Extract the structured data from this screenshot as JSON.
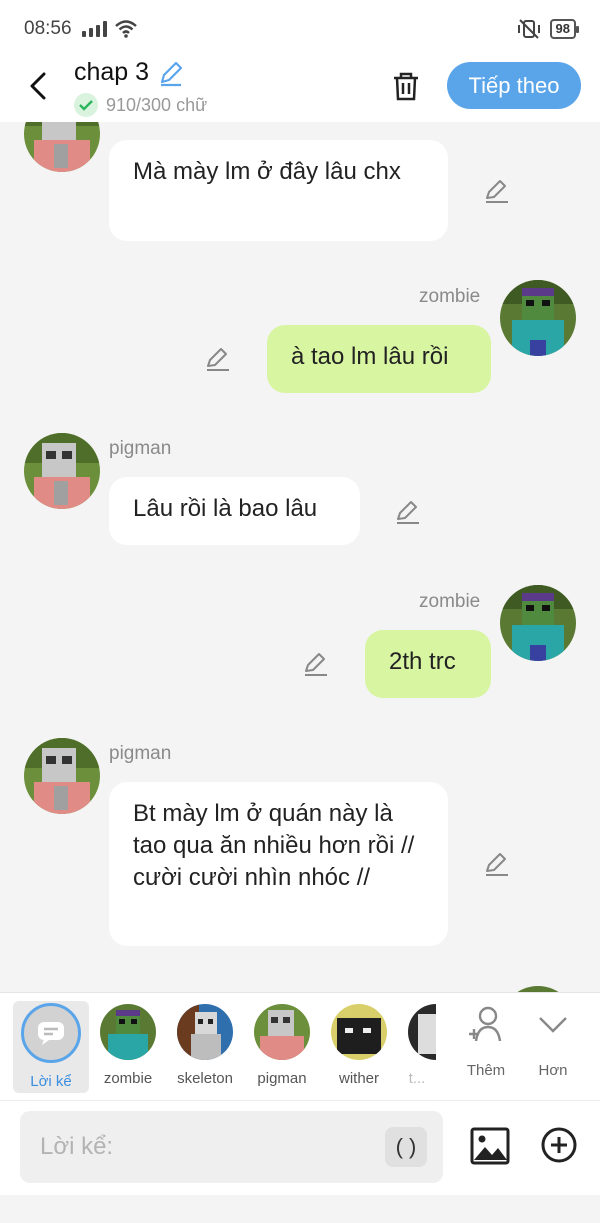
{
  "status_bar": {
    "time": "08:56",
    "battery": "98"
  },
  "header": {
    "title": "chap 3",
    "word_count": "910/300 chữ",
    "next_label": "Tiếp theo",
    "accent": "#5aa5ea"
  },
  "messages": [
    {
      "side": "left",
      "name": "",
      "text": "Mà mày lm ở đây lâu chx"
    },
    {
      "side": "right",
      "name": "zombie",
      "text": "à tao lm lâu rồi"
    },
    {
      "side": "left",
      "name": "pigman",
      "text": "Lâu rồi là bao lâu"
    },
    {
      "side": "right",
      "name": "zombie",
      "text": "2th trc"
    },
    {
      "side": "left",
      "name": "pigman",
      "text": "Bt mày lm ở quán này là tao qua ăn nhiều hơn rồi // cười cười nhìn nhóc //"
    }
  ],
  "characters": [
    {
      "label": "Lời kể"
    },
    {
      "label": "zombie"
    },
    {
      "label": "skeleton"
    },
    {
      "label": "pigman"
    },
    {
      "label": "wither"
    },
    {
      "label": "t..."
    }
  ],
  "tools": {
    "add_label": "Thêm",
    "more_label": "Hơn"
  },
  "composer": {
    "placeholder": "Lời kể:",
    "paren": "( )"
  },
  "colors": {
    "right_bubble": "#d8f5a2",
    "left_bubble": "#ffffff"
  }
}
